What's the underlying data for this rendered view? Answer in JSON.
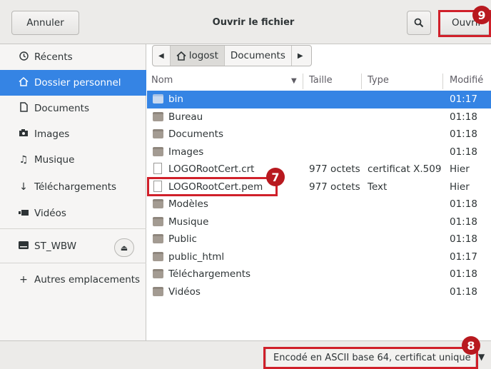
{
  "header": {
    "cancel_label": "Annuler",
    "title": "Ouvrir le fichier",
    "search_icon": "search-icon",
    "open_label": "Ouvrir"
  },
  "sidebar": {
    "items": [
      {
        "label": "Récents",
        "icon": "clock-icon"
      },
      {
        "label": "Dossier personnel",
        "icon": "home-icon",
        "active": true
      },
      {
        "label": "Documents",
        "icon": "document-icon"
      },
      {
        "label": "Images",
        "icon": "camera-icon"
      },
      {
        "label": "Musique",
        "icon": "music-icon"
      },
      {
        "label": "Téléchargements",
        "icon": "download-icon"
      },
      {
        "label": "Vidéos",
        "icon": "video-icon"
      },
      {
        "label": "ST_WBW",
        "icon": "drive-icon"
      },
      {
        "label": "Autres emplacements",
        "icon": "plus-icon"
      }
    ]
  },
  "pathbar": {
    "segments": [
      "logost",
      "Documents"
    ]
  },
  "columns": {
    "name": "Nom",
    "size": "Taille",
    "type": "Type",
    "modified": "Modifié"
  },
  "files": [
    {
      "name": "bin",
      "size": "",
      "type": "",
      "modified": "01:17",
      "kind": "folder"
    },
    {
      "name": "Bureau",
      "size": "",
      "type": "",
      "modified": "01:18",
      "kind": "folder"
    },
    {
      "name": "Documents",
      "size": "",
      "type": "",
      "modified": "01:18",
      "kind": "folder"
    },
    {
      "name": "Images",
      "size": "",
      "type": "",
      "modified": "01:18",
      "kind": "folder"
    },
    {
      "name": "LOGORootCert.crt",
      "size": "977 octets",
      "type": "certificat X.509",
      "modified": "Hier",
      "kind": "file"
    },
    {
      "name": "LOGORootCert.pem",
      "size": "977 octets",
      "type": "Text",
      "modified": "Hier",
      "kind": "file"
    },
    {
      "name": "Modèles",
      "size": "",
      "type": "",
      "modified": "01:18",
      "kind": "folder"
    },
    {
      "name": "Musique",
      "size": "",
      "type": "",
      "modified": "01:18",
      "kind": "folder"
    },
    {
      "name": "Public",
      "size": "",
      "type": "",
      "modified": "01:18",
      "kind": "folder"
    },
    {
      "name": "public_html",
      "size": "",
      "type": "",
      "modified": "01:17",
      "kind": "folder"
    },
    {
      "name": "Téléchargements",
      "size": "",
      "type": "",
      "modified": "01:18",
      "kind": "folder"
    },
    {
      "name": "Vidéos",
      "size": "",
      "type": "",
      "modified": "01:18",
      "kind": "folder"
    }
  ],
  "filter": {
    "selected": "Encodé en ASCII base 64, certificat unique"
  },
  "annotations": {
    "step_open": "9",
    "step_file": "7",
    "step_filter": "8",
    "color": "#d0202a"
  }
}
